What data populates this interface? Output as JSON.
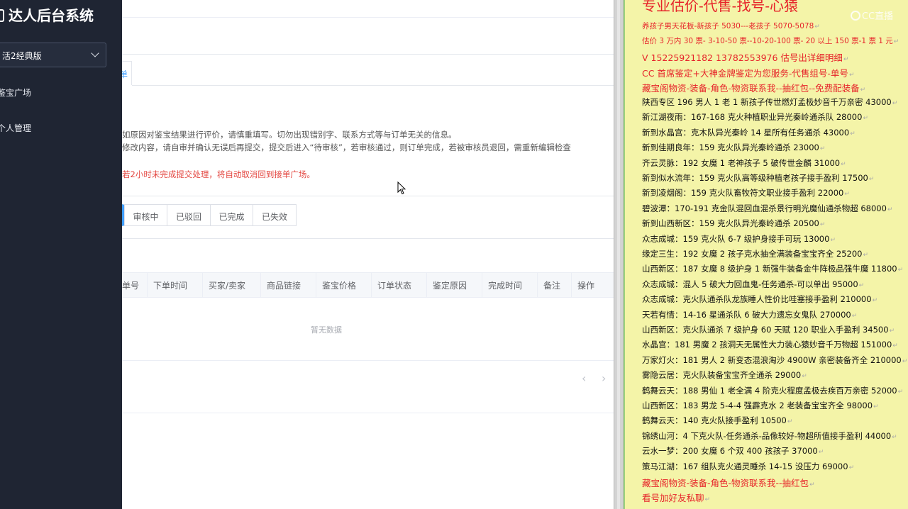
{
  "sidebar": {
    "title": "达人后台系统",
    "version_select": "活2经典版",
    "nav": [
      "鉴宝广场",
      "个人管理"
    ]
  },
  "main": {
    "tab_label": "单",
    "notices": [
      "如原因对鉴宝结果进行评价，请慎重填写。切勿出现错别字、联系方式等与订单无关的信息。",
      "修改内容，请自审并确认无误后再提交，提交后进入“待审核”，若审核通过，则订单完成，若被审核员退回，需重新编辑检查",
      "若2小时未完成提交处理，将自动取消回到接单广场。"
    ],
    "status_tabs": [
      "",
      "审核中",
      "已驳回",
      "已完成",
      "已失效"
    ],
    "columns": [
      "单号",
      "下单时间",
      "买家/卖家",
      "商品链接",
      "鉴宝价格",
      "订单状态",
      "鉴定原因",
      "完成时间",
      "备注",
      "操作"
    ],
    "empty_text": "暂无数据",
    "pager": [
      "‹",
      "›"
    ]
  },
  "doc": {
    "title": "专业估价-代售-找号-心猿",
    "logo": "CC直播",
    "lines": [
      {
        "text": "养孩子男天花板-新孩子 5030---老孩子 5070-5078",
        "style": "red small"
      },
      {
        "text": "估价 3 万内 30 票- 3-10-50 票--10-20-100 票- 20 以上 150 票-1 票 1 元",
        "style": "red small"
      },
      {
        "text": "V 15225921182    13782553976    估号出详细明细",
        "style": "red"
      },
      {
        "text": "CC 首席鉴定+大神金牌鉴定为您服务-代售组号-单号",
        "style": "red"
      },
      {
        "text": "藏宝阁物资-装备-角色-物资联系我--抽红包--免费配装备",
        "style": "red"
      },
      {
        "text": "陕西专区 196 男人 1 老 1 新孩子传世燃灯孟极妙音千万亲密 43000",
        "style": ""
      },
      {
        "text": "新江湖夜雨：167-168 克火种植职业异光秦岭通杀队 28000",
        "style": ""
      },
      {
        "text": "新到水晶宫：克木队异光秦岭 14 星所有任务通杀 43000",
        "style": ""
      },
      {
        "text": "新到佳期良年：159 克火队异光秦岭通杀 23000",
        "style": ""
      },
      {
        "text": "齐云灵脉：192 女魔 1 老神孩子 5 破传世金麟 31000",
        "style": ""
      },
      {
        "text": "新到似水流年：159 克火队高等级种植老孩子接手盈利 17500",
        "style": ""
      },
      {
        "text": "新到凌烟阁：159 克火队畜牧符文职业接手盈利 22000",
        "style": ""
      },
      {
        "text": "碧波潭：170-191 克金队混回血混杀景行明光魔仙通杀物超 68000",
        "style": ""
      },
      {
        "text": "新到山西新区：159 克火队异光秦岭通杀 20500",
        "style": ""
      },
      {
        "text": "众志成城：159 克火队 6-7 级护身接手可玩 13000",
        "style": ""
      },
      {
        "text": "缘定三生：192 女魔 2 孩子克水抽全满装备宝宝齐全 25200",
        "style": ""
      },
      {
        "text": "山西新区：187 女魔 8 级护身 1 新强牛装备金牛阵极品强牛魔 11800",
        "style": ""
      },
      {
        "text": "众志成城：混人 5 破大力回血鬼-任务通杀-可以单出 95000",
        "style": ""
      },
      {
        "text": "众志成城：克火队通杀队龙族睡人性价比哇塞接手盈利 210000",
        "style": ""
      },
      {
        "text": "天若有情：14-16 星通杀队 6 破大力遗忘女鬼队 270000",
        "style": ""
      },
      {
        "text": "山西新区：克火队通杀 7 级护身 60 天赋 120 职业入手盈利 34500",
        "style": ""
      },
      {
        "text": "水晶宫：181 男魔 2 孩洞天无属性大力装心猿妙音千万物超 151000",
        "style": ""
      },
      {
        "text": "万家灯火：181 男人 2 新变态混浪淘沙 4900W 亲密装备齐全 210000",
        "style": ""
      },
      {
        "text": "雾隐云居：克火队装备宝宝齐全通杀 29000",
        "style": ""
      },
      {
        "text": "鹤舞云天：188 男仙 1 老全满 4 阶克火程度孟极去疾百万亲密 52000",
        "style": ""
      },
      {
        "text": "山西新区：183 男龙 5-4-4 强霹克水 2 老装备宝宝齐全 98000",
        "style": ""
      },
      {
        "text": "鹤舞云天：140 克火队接手盈利 10500",
        "style": ""
      },
      {
        "text": "锦绣山河：4 下克火队-任务通杀-品像较好-物超所值接手盈利 44000",
        "style": ""
      },
      {
        "text": "云水一梦：200 女魔 6 个双 400 孩孩子 37000",
        "style": ""
      },
      {
        "text": "策马江湖：167 组队克火通灵睡杀 14-15 没压力 69000",
        "style": ""
      },
      {
        "text": "藏宝阁物资-装备-角色-物资联系我--抽红包",
        "style": "red"
      },
      {
        "text": "看号加好友私聊",
        "style": "red"
      }
    ]
  },
  "colors": {
    "sidebar_bg": "#1f2533",
    "accent": "#409eff",
    "notice_red": "#e3453f",
    "doc_bg": "#f4f4a8",
    "doc_red": "#e6242a"
  }
}
